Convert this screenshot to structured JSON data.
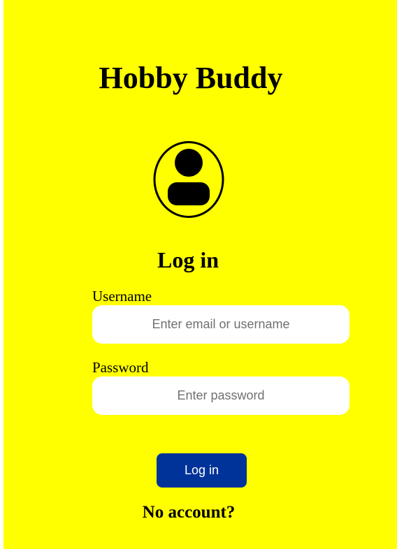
{
  "app": {
    "title": "Hobby Buddy"
  },
  "avatar": {
    "icon": "user-icon"
  },
  "login_form": {
    "heading": "Log in",
    "username_label": "Username",
    "username_placeholder": "Enter email or username",
    "username_value": "",
    "password_label": "Password",
    "password_placeholder": "Enter password",
    "password_value": "",
    "submit_label": "Log in",
    "no_account_link": "No account?"
  },
  "colors": {
    "background": "#ffff00",
    "button": "#003399",
    "button_text": "#ffffff",
    "input_background": "#ffffff",
    "text": "#000000"
  }
}
